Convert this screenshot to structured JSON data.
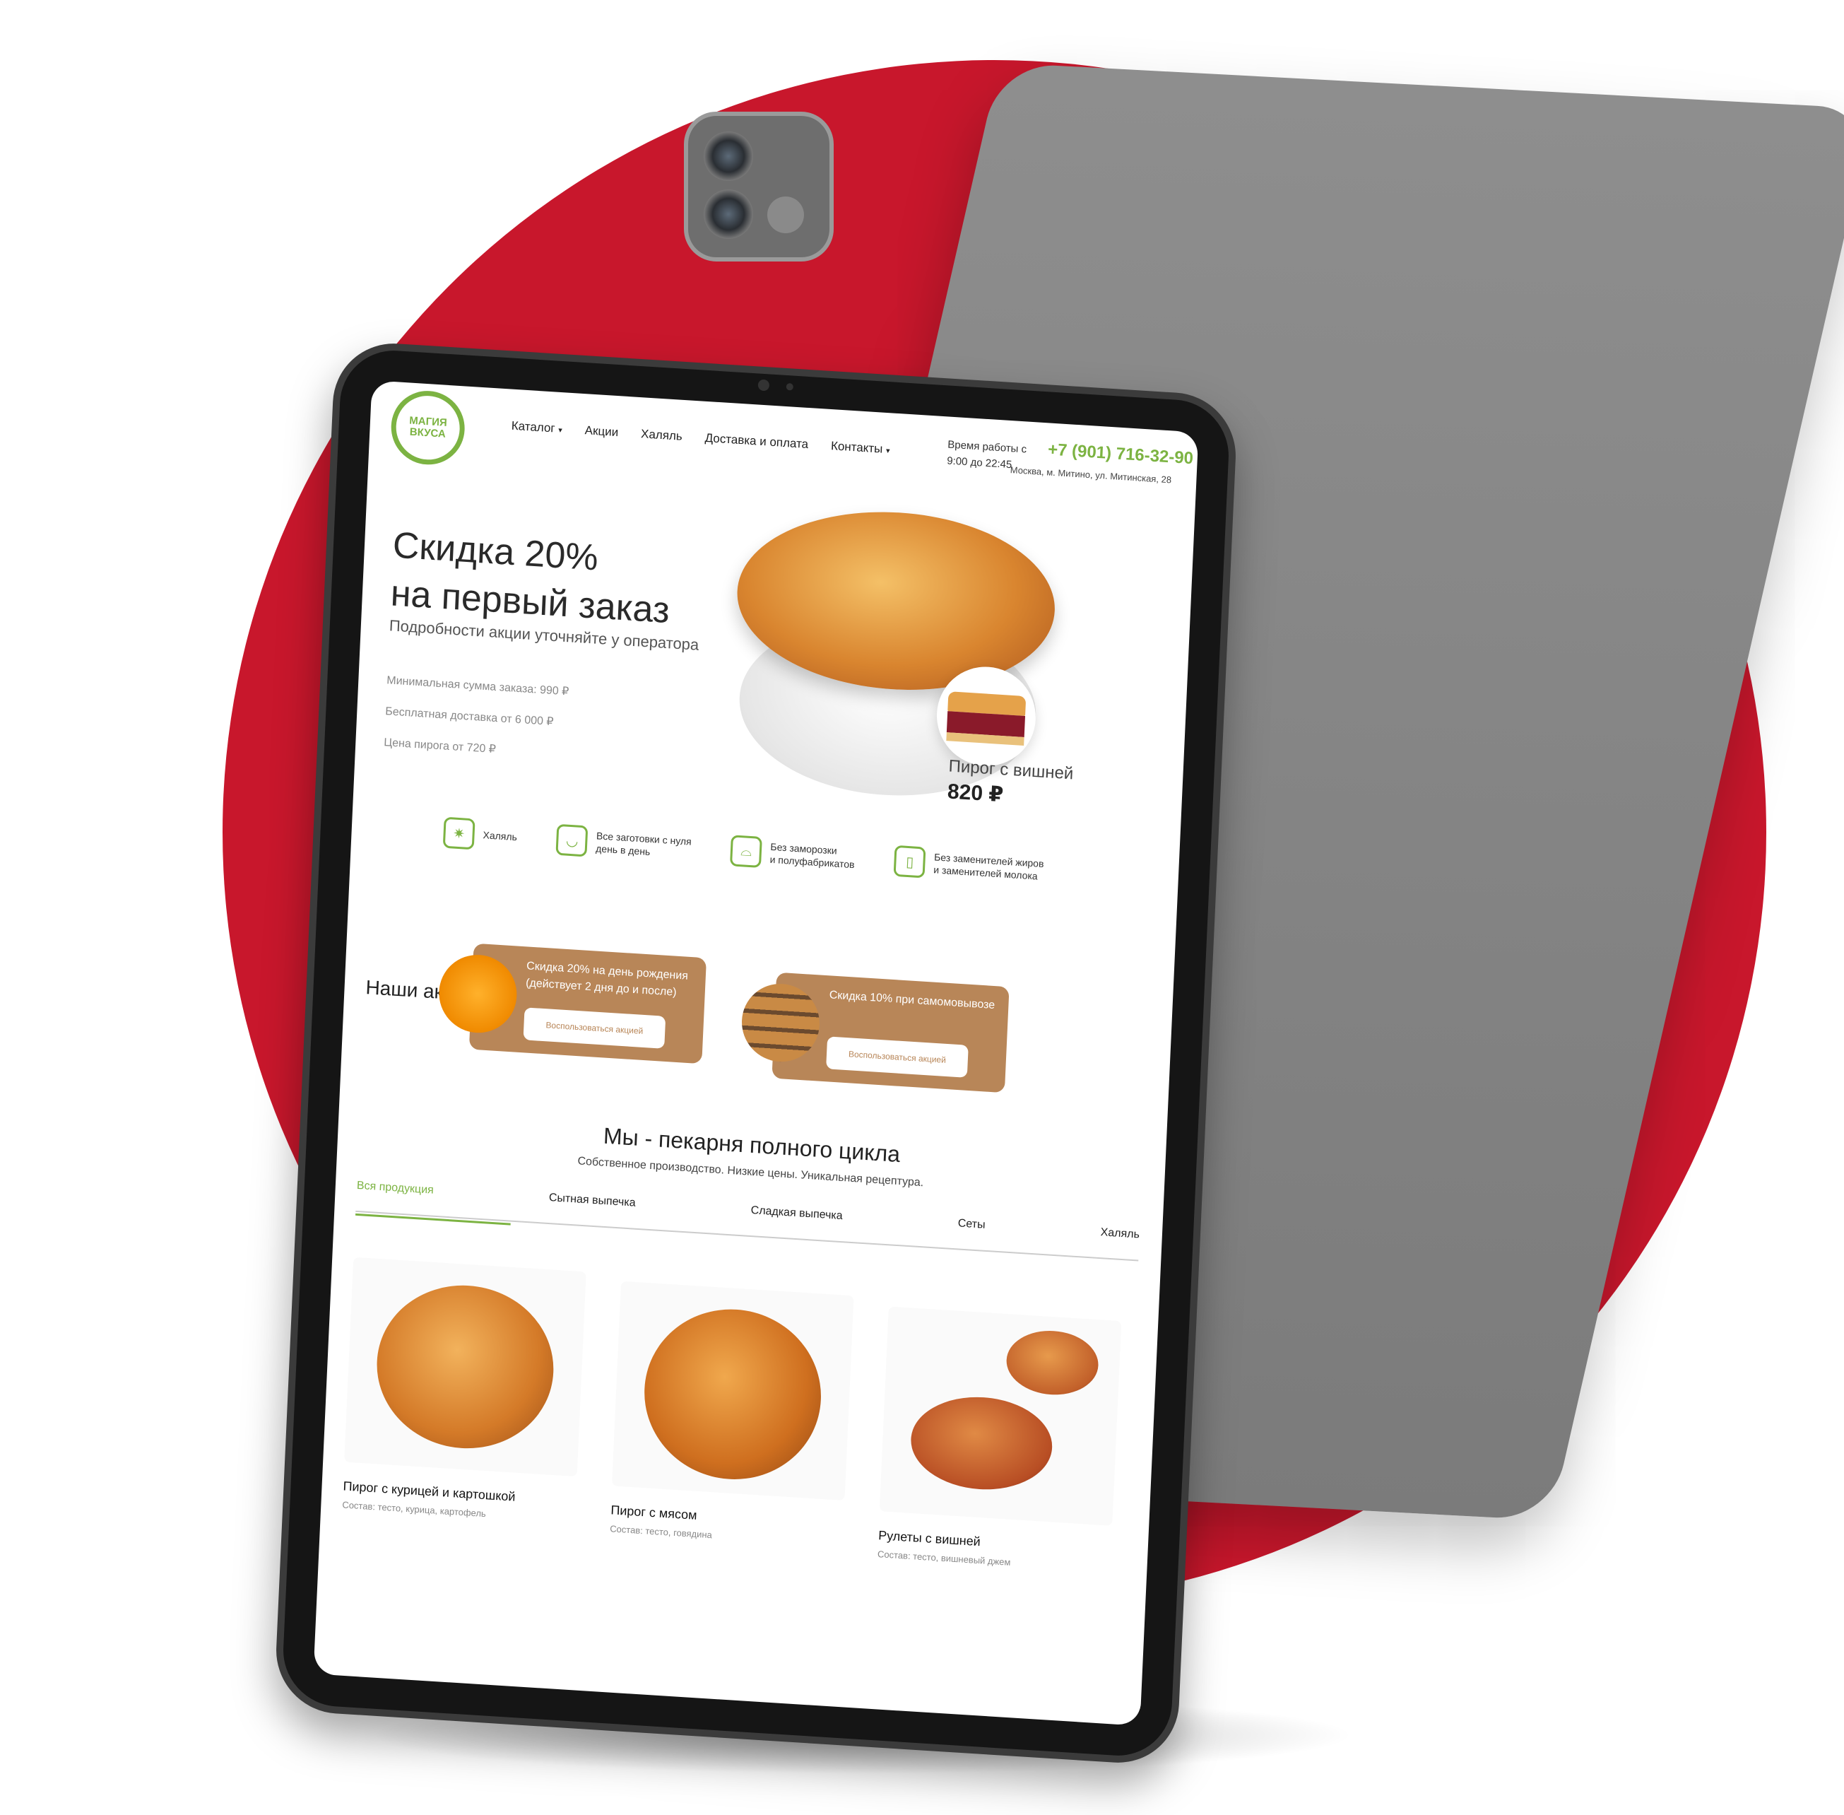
{
  "logo": {
    "text": "МАГИЯ ВКУСА"
  },
  "nav": {
    "catalog": "Каталог",
    "promos": "Акции",
    "halal": "Халяль",
    "delivery": "Доставка и оплата",
    "contacts": "Контакты",
    "dropdown_marker": "▾"
  },
  "header": {
    "hours_line1": "Время работы с",
    "hours_line2": "9:00 до 22:45",
    "phone": "+7 (901) 716-32-90",
    "address": "Москва, м. Митино, ул. Митинская, 28"
  },
  "hero": {
    "title_line1": "Скидка 20%",
    "title_line2": "на первый заказ",
    "subtitle": "Подробности акции уточняйте у оператора",
    "min_order": "Минимальная сумма заказа: 990 ₽",
    "free_delivery": "Бесплатная доставка от 6 000 ₽",
    "pie_price_from": "Цена пирога от 720 ₽",
    "featured_name": "Пирог с вишней",
    "featured_price": "820 ₽"
  },
  "features": [
    {
      "label": "Халяль"
    },
    {
      "label_line1": "Все заготовки с нуля",
      "label_line2": "день в день"
    },
    {
      "label_line1": "Без заморозки",
      "label_line2": "и полуфабрикатов"
    },
    {
      "label_line1": "Без заменителей жиров",
      "label_line2": "и заменителей молока"
    }
  ],
  "promos": {
    "title": "Наши акции",
    "cards": [
      {
        "text": "Скидка 20% на день рождения (действует 2 дня до и после)",
        "button": "Воспользоваться акцией"
      },
      {
        "text": "Скидка 10% при самомовывозе",
        "button": "Воспользоваться акцией"
      }
    ]
  },
  "products_section": {
    "title": "Мы - пекарня полного цикла",
    "subtitle": "Собственное производство. Низкие цены. Уникальная рецептура.",
    "tabs": [
      "Вся продукция",
      "Сытная выпечка",
      "Сладкая выпечка",
      "Сеты",
      "Халяль"
    ],
    "active_tab": "Вся продукция",
    "items": [
      {
        "name": "Пирог с курицей и картошкой",
        "desc": "Состав: тесто, курица, картофель"
      },
      {
        "name": "Пирог с мясом",
        "desc": "Состав: тесто, говядина"
      },
      {
        "name": "Рулеты с вишней",
        "desc": "Состав: тесто, вишневый джем"
      }
    ]
  },
  "colors": {
    "brand_green": "#7cb342",
    "brand_red": "#c8172c",
    "card_brown": "#b88658"
  }
}
